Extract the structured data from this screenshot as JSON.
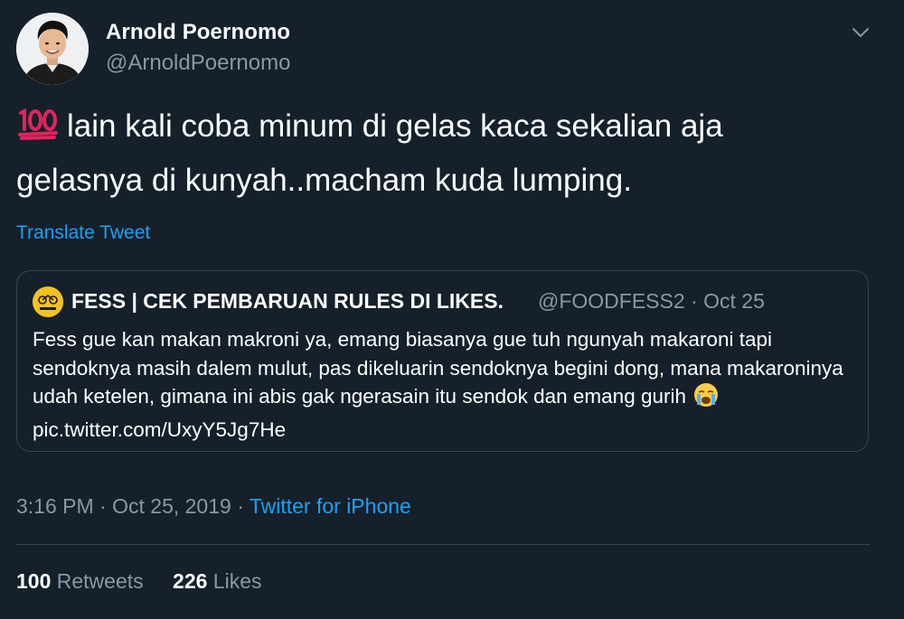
{
  "tweet": {
    "author_name": "Arnold Poernomo",
    "author_handle": "@ArnoldPoernomo",
    "menu_icon": "chevron-down-icon",
    "emoji": "hundred-points-icon",
    "text_line1": "lain kali coba minum di gelas kaca sekalian aja",
    "text_line2": "gelasnya di kunyah..macham kuda lumping.",
    "translate_label": "Translate Tweet",
    "time": "3:16 PM",
    "date": "Oct 25, 2019",
    "source": "Twitter for iPhone",
    "retweets": "100",
    "retweets_label": "Retweets",
    "likes": "226",
    "likes_label": "Likes"
  },
  "quoted": {
    "author_name": "FESS | CEK PEMBARUAN RULES DI LIKES.",
    "author_handle": "@FOODFESS2",
    "date": "Oct 25",
    "text": "Fess gue kan makan makroni ya, emang biasanya gue tuh ngunyah makaroni tapi sendoknya masih dalem mulut, pas dikeluarin sendoknya begini dong, mana makaroninya udah ketelen, gimana ini abis gak ngerasain itu sendok dan emang gurih",
    "emoji": "loudly-crying-face-icon",
    "link": "pic.twitter.com/UxyY5Jg7He"
  },
  "colors": {
    "background": "#15202b",
    "accent": "#1da1f2",
    "secondary_text": "#8899a6",
    "border": "#38444d"
  }
}
